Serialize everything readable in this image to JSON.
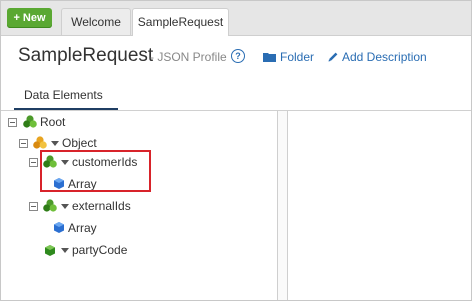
{
  "toolbar": {
    "new_label": "+ New"
  },
  "tabs": [
    {
      "label": "Welcome"
    },
    {
      "label": "SampleRequest"
    }
  ],
  "header": {
    "title": "SampleRequest",
    "subtitle": "- JSON Profile",
    "help": "?",
    "folder_label": "Folder",
    "add_description_label": "Add Description"
  },
  "section_tab": "Data Elements",
  "tree": {
    "root": "Root",
    "object": "Object",
    "customerIds": "customerIds",
    "customerIds_array": "Array",
    "externalIds": "externalIds",
    "externalIds_array": "Array",
    "partyCode": "partyCode"
  },
  "colors": {
    "accent_green": "#5aa832",
    "link_blue": "#2a6db3",
    "highlight_red": "#d8232a"
  }
}
